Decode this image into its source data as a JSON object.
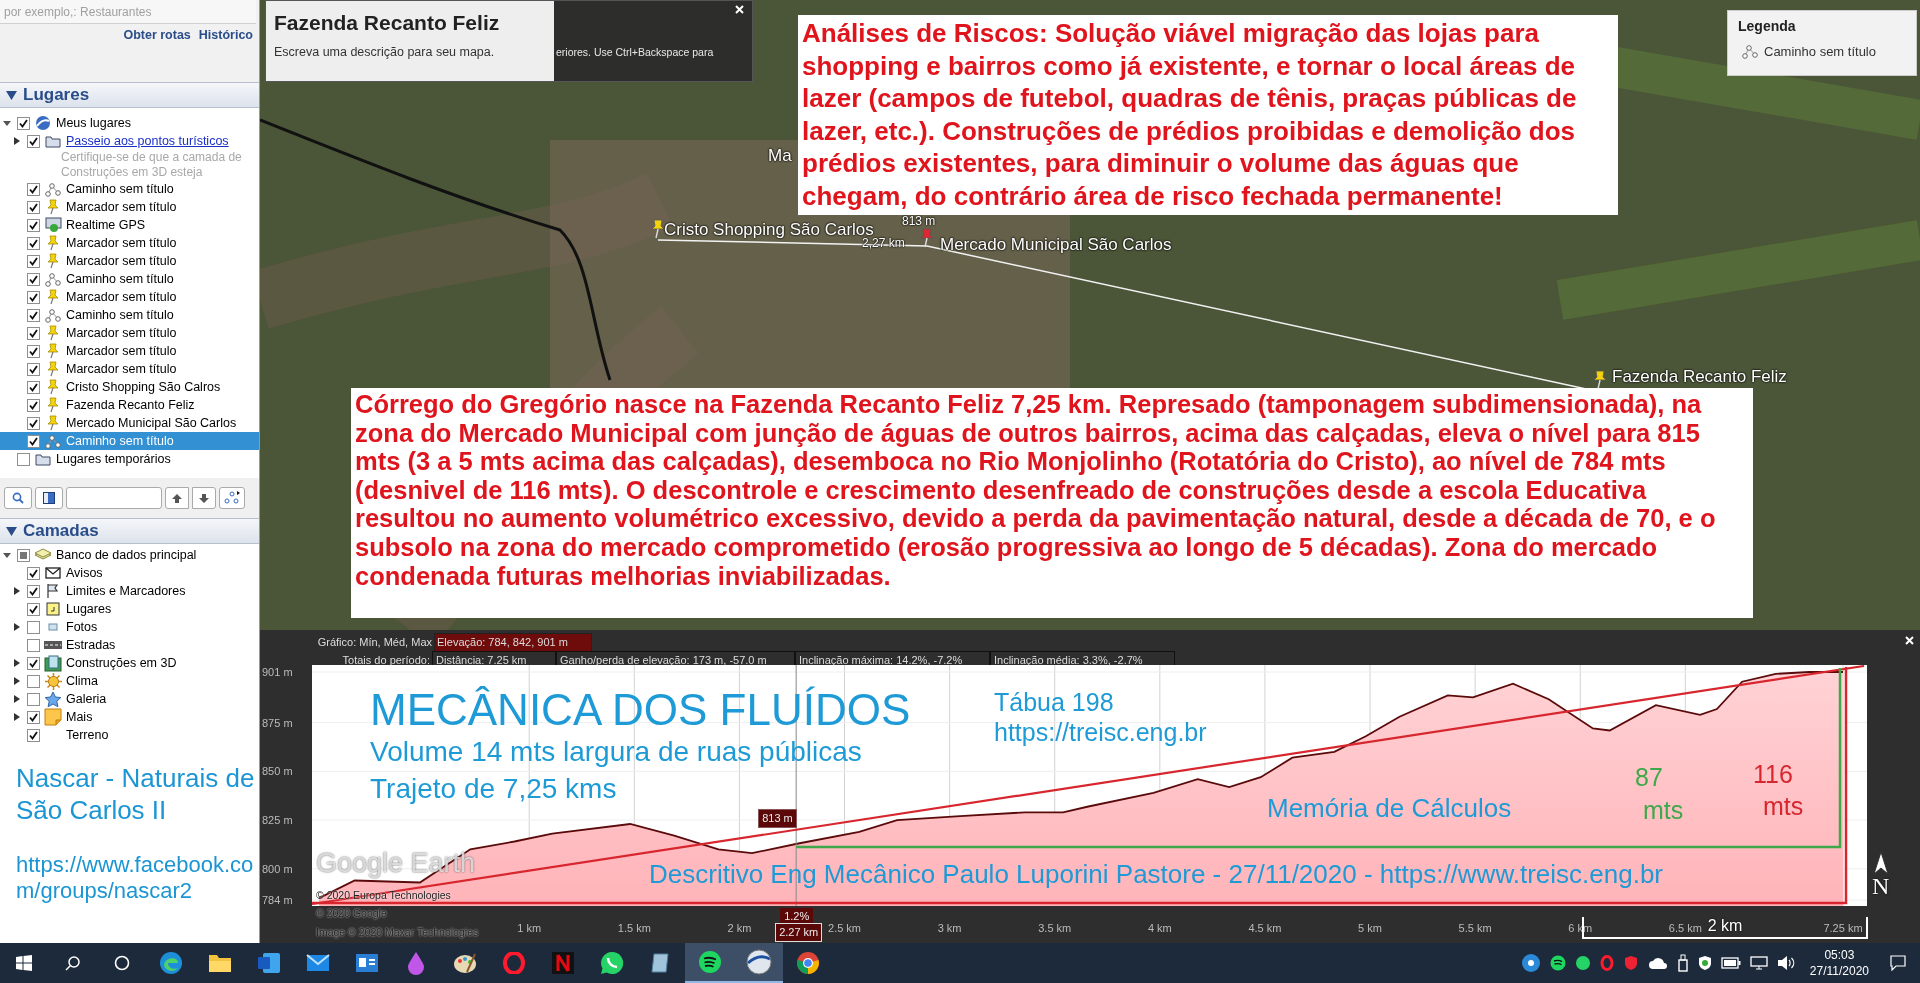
{
  "search": {
    "placeholder": "por exemplo,: Restaurantes",
    "links": [
      "Obter rotas",
      "Histórico"
    ]
  },
  "places": {
    "title": "Lugares",
    "expanded": true,
    "items": [
      {
        "label": "Meus lugares",
        "kind": "globe",
        "checked": true,
        "expanded": true,
        "selected": false,
        "children": [
          {
            "label": "Passeio aos pontos turísticos",
            "kind": "folder",
            "checked": true,
            "expanded": false,
            "link": true,
            "selected": false,
            "description": "Certifique-se de que a camada de Construções em 3D esteja"
          },
          {
            "label": "Caminho sem título",
            "kind": "path",
            "checked": true,
            "selected": false
          },
          {
            "label": "Marcador sem título",
            "kind": "pin",
            "checked": true,
            "selected": false
          },
          {
            "label": "Realtime GPS",
            "kind": "gps",
            "checked": true,
            "selected": false
          },
          {
            "label": "Marcador sem título",
            "kind": "pin",
            "checked": true,
            "selected": false
          },
          {
            "label": "Marcador sem título",
            "kind": "pin",
            "checked": true,
            "selected": false
          },
          {
            "label": "Caminho sem título",
            "kind": "path",
            "checked": true,
            "selected": false
          },
          {
            "label": "Marcador sem título",
            "kind": "pin",
            "checked": true,
            "selected": false
          },
          {
            "label": "Caminho sem título",
            "kind": "path",
            "checked": true,
            "selected": false
          },
          {
            "label": "Marcador sem título",
            "kind": "pin",
            "checked": true,
            "selected": false
          },
          {
            "label": "Marcador sem título",
            "kind": "pin",
            "checked": true,
            "selected": false
          },
          {
            "label": "Marcador sem título",
            "kind": "pin",
            "checked": true,
            "selected": false
          },
          {
            "label": "Cristo Shopping São Calros",
            "kind": "pin",
            "checked": true,
            "selected": false
          },
          {
            "label": "Fazenda Recanto Feliz",
            "kind": "pin",
            "checked": true,
            "selected": false
          },
          {
            "label": "Mercado Municipal São Carlos",
            "kind": "pin",
            "checked": true,
            "selected": false
          },
          {
            "label": "Caminho sem título",
            "kind": "path",
            "checked": true,
            "selected": true
          }
        ]
      },
      {
        "label": "Lugares temporários",
        "kind": "folder",
        "checked": false,
        "selected": false
      }
    ]
  },
  "layers": {
    "title": "Camadas",
    "expanded": true,
    "items": [
      {
        "label": "Banco de dados principal",
        "kind": "database",
        "mixed": true,
        "expanded": true,
        "children": [
          {
            "label": "Avisos",
            "kind": "mail",
            "checked": true
          },
          {
            "label": "Limites e Marcadores",
            "kind": "flag",
            "checked": true,
            "expanded": false
          },
          {
            "label": "Lugares",
            "kind": "place",
            "checked": true
          },
          {
            "label": "Fotos",
            "kind": "photo",
            "checked": false,
            "expanded": false
          },
          {
            "label": "Estradas",
            "kind": "road",
            "checked": false
          },
          {
            "label": "Construções em 3D",
            "kind": "building",
            "checked": true,
            "expanded": false
          },
          {
            "label": "Clima",
            "kind": "sun",
            "checked": false,
            "expanded": false
          },
          {
            "label": "Galeria",
            "kind": "star",
            "checked": false,
            "expanded": false
          },
          {
            "label": "Mais",
            "kind": "note",
            "checked": true,
            "expanded": false
          },
          {
            "label": "Terreno",
            "kind": "plain",
            "checked": true
          }
        ]
      }
    ]
  },
  "sidebar_note": {
    "title": "Nascar - Naturais de São Carlos II",
    "link": "https://www.facebook.com/groups/nascar2"
  },
  "map": {
    "popup": {
      "title": "Fazenda Recanto Feliz",
      "hint": "eriores. Use Ctrl+Backspace para",
      "description": "Escreva uma descrição para seu mapa."
    },
    "labels": [
      {
        "text": "Ma",
        "kind": "place"
      },
      {
        "text": "Cristo Shopping São Carlos",
        "kind": "pin"
      },
      {
        "text": "813 m",
        "kind": "measure"
      },
      {
        "text": "2,27 km",
        "kind": "measure"
      },
      {
        "text": "Mercado Municipal São Carlos",
        "kind": "pin-red"
      },
      {
        "text": "Fazenda Recanto Feliz",
        "kind": "pin"
      }
    ],
    "risk_note": "Análises de Riscos: Solução viável migração das lojas para shopping e bairros como já existente, e tornar o local áreas de lazer (campos de futebol, quadras de tênis, praças públicas de lazer, etc.). Construções de prédios proibidas e demolição dos prédios existentes, para diminuir o volume das águas que chegam, do contrário área de risco fechada permanente!",
    "legend": {
      "title": "Legenda",
      "items": [
        "Caminho sem título"
      ]
    },
    "stream_note": "Córrego do Gregório nasce na Fazenda Recanto Feliz 7,25 km. Represado (tamponagem subdimensionada), na zona do Mercado Municipal com junção de águas de outros bairros, acima das calçadas, eleva o nível para 815 mts (3 a 5 mts acima das calçadas), desemboca no Rio Monjolinho (Rotatória do Cristo), ao nível de 784 mts (desnivel de 116 mts). O descontrole e crescimento desenfreado de construções desde a escola Educativa resultou no aumento volumétrico excessivo, devido a perda da pavimentação natural, desde a década de 70, e o subsolo na zona do mercado comprometido (erosão progressiva ao longo de 5 décadas). Zona do mercado condenada futuras melhorias inviabilizadas."
  },
  "elevation": {
    "graph_label": "Gráfico: Mín, Méd, Max",
    "graph_value": "Elevação: 784, 842, 901 m",
    "totals_label": "Totais do período:",
    "totals": [
      "Distância: 7.25 km",
      "Ganho/perda de elevação: 173 m, -57.0 m",
      "Inclinação máxima: 14.2%, -7.2%",
      "Inclinação média: 3.3%, -2.7%"
    ],
    "cursor": {
      "elevation": "813 m",
      "slope": "1.2%"
    },
    "chart_data": {
      "type": "area",
      "x": [
        0,
        0.17,
        0.48,
        0.72,
        0.93,
        1.11,
        1.48,
        1.69,
        1.9,
        2.06,
        2.28,
        2.57,
        2.75,
        3.05,
        3.36,
        3.54,
        3.66,
        3.97,
        4.18,
        4.33,
        4.48,
        4.63,
        4.83,
        4.98,
        5.14,
        5.37,
        5.49,
        5.68,
        5.85,
        6.06,
        6.14,
        6.36,
        6.57,
        6.65,
        6.77,
        6.93,
        7.09,
        7.25
      ],
      "series": [
        {
          "color": "#5a0a0a",
          "values": [
            785,
            794,
            793,
            810,
            814,
            818,
            823,
            817,
            810,
            808,
            813,
            819,
            825,
            827,
            829,
            829,
            832,
            839,
            846,
            842,
            847,
            857,
            860,
            868,
            878,
            889,
            888,
            895,
            887,
            872,
            871,
            884,
            879,
            882,
            896,
            900,
            901,
            901
          ]
        }
      ],
      "xlim": [
        0,
        7.25
      ],
      "ylim": [
        784,
        901
      ],
      "xticks": [
        {
          "value": 1,
          "label": "1 km"
        },
        {
          "value": 1.5,
          "label": "1.5 km"
        },
        {
          "value": 2,
          "label": "2 km"
        },
        {
          "value": 2.5,
          "label": "2.5 km"
        },
        {
          "value": 3,
          "label": "3 km"
        },
        {
          "value": 3.5,
          "label": "3.5 km"
        },
        {
          "value": 4,
          "label": "4 km"
        },
        {
          "value": 4.5,
          "label": "4.5 km"
        },
        {
          "value": 5,
          "label": "5 km"
        },
        {
          "value": 5.5,
          "label": "5.5 km"
        },
        {
          "value": 6,
          "label": "6 km"
        },
        {
          "value": 6.5,
          "label": "6.5 km"
        },
        {
          "value": 7.25,
          "label": "7.25 km"
        }
      ],
      "yticks": [
        {
          "value": 901,
          "label": "901 m"
        },
        {
          "value": 875,
          "label": "875 m"
        },
        {
          "value": 850,
          "label": "850 m"
        },
        {
          "value": 825,
          "label": "825 m"
        },
        {
          "value": 800,
          "label": "800 m"
        },
        {
          "value": 784,
          "label": "784 m"
        }
      ],
      "grid": true,
      "ref_lines": [
        {
          "axis": "x",
          "value": 2.27,
          "label": "2.27 km",
          "color": "#888888"
        }
      ]
    },
    "overlay_texts": [
      {
        "text": "MECÂNICA DOS FLUÍDOS",
        "color": "#1e9ad6"
      },
      {
        "text": "Volume 14 mts largura de ruas públicas",
        "color": "#1e9ad6"
      },
      {
        "text": "Trajeto de 7,25 kms",
        "color": "#1e9ad6"
      },
      {
        "text": "Tábua 198",
        "color": "#1e9ad6"
      },
      {
        "text": "https://treisc.eng.br",
        "color": "#1e9ad6"
      },
      {
        "text": "Memória de Cálculos",
        "color": "#1e9ad6"
      },
      {
        "text": "87",
        "color": "#3ea84a"
      },
      {
        "text": "mts",
        "color": "#3ea84a"
      },
      {
        "text": "116",
        "color": "#d8262e"
      },
      {
        "text": "mts",
        "color": "#d8262e"
      },
      {
        "text": "Descritivo Eng Mecânico Paulo Luporini Pastore - 27/11/2020 - https://www.treisc.eng.br",
        "color": "#1e9ad6"
      }
    ],
    "logo": "Google Earth",
    "attributions": [
      "© 2020 Europa Technologies",
      "© 2020 Google",
      "Image © 2020 Maxar Technologies"
    ],
    "compass": "N",
    "scale": "2 km"
  },
  "taskbar": {
    "apps": [
      {
        "kind": "search",
        "active": false
      },
      {
        "kind": "circle",
        "active": false
      },
      {
        "kind": "browser",
        "active": false
      },
      {
        "kind": "folder",
        "active": false
      },
      {
        "kind": "document",
        "active": false
      },
      {
        "kind": "mail",
        "active": false
      },
      {
        "kind": "card",
        "active": false
      },
      {
        "kind": "drop",
        "active": false
      },
      {
        "kind": "palette",
        "active": false
      },
      {
        "kind": "ring",
        "active": false
      },
      {
        "kind": "tile",
        "active": false
      },
      {
        "kind": "chat",
        "active": false
      },
      {
        "kind": "notebook",
        "active": false
      },
      {
        "kind": "music",
        "active": true
      },
      {
        "kind": "globe",
        "active": true
      },
      {
        "kind": "chrome",
        "active": false
      }
    ],
    "time": "05:03",
    "date": "27/11/2020"
  }
}
